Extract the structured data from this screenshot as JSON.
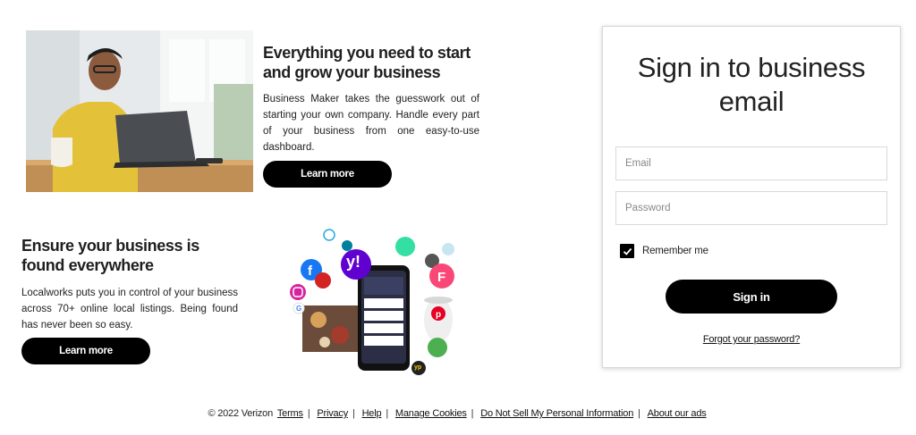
{
  "promo1": {
    "title": "Everything you need to start and grow your business",
    "description": "Business Maker takes the guesswork out of starting your own company. Handle every part of your business from one easy-to-use dashboard.",
    "button_label": "Learn more"
  },
  "promo2": {
    "title": "Ensure your business is found everywhere",
    "description": "Localworks puts you in control of your business across 70+ online local listings. Being found has never been so easy.",
    "button_label": "Learn more"
  },
  "app_logos": {
    "yahoo": "y!",
    "yp": "yp"
  },
  "signin": {
    "title": "Sign in to business email",
    "email_placeholder": "Email",
    "password_placeholder": "Password",
    "remember_label": "Remember me",
    "remember_checked": true,
    "submit_label": "Sign in",
    "forgot_label": "Forgot your password?"
  },
  "footer": {
    "copyright": "© 2022 Verizon",
    "links": [
      "Terms",
      "Privacy",
      "Help",
      "Manage Cookies",
      "Do Not Sell My Personal Information",
      "About our ads"
    ]
  },
  "colors": {
    "button_bg": "#000000",
    "yahoo_purple": "#6001d2",
    "facebook_blue": "#1877f2",
    "foursquare_pink": "#f94877",
    "pinterest_red": "#e60023"
  }
}
